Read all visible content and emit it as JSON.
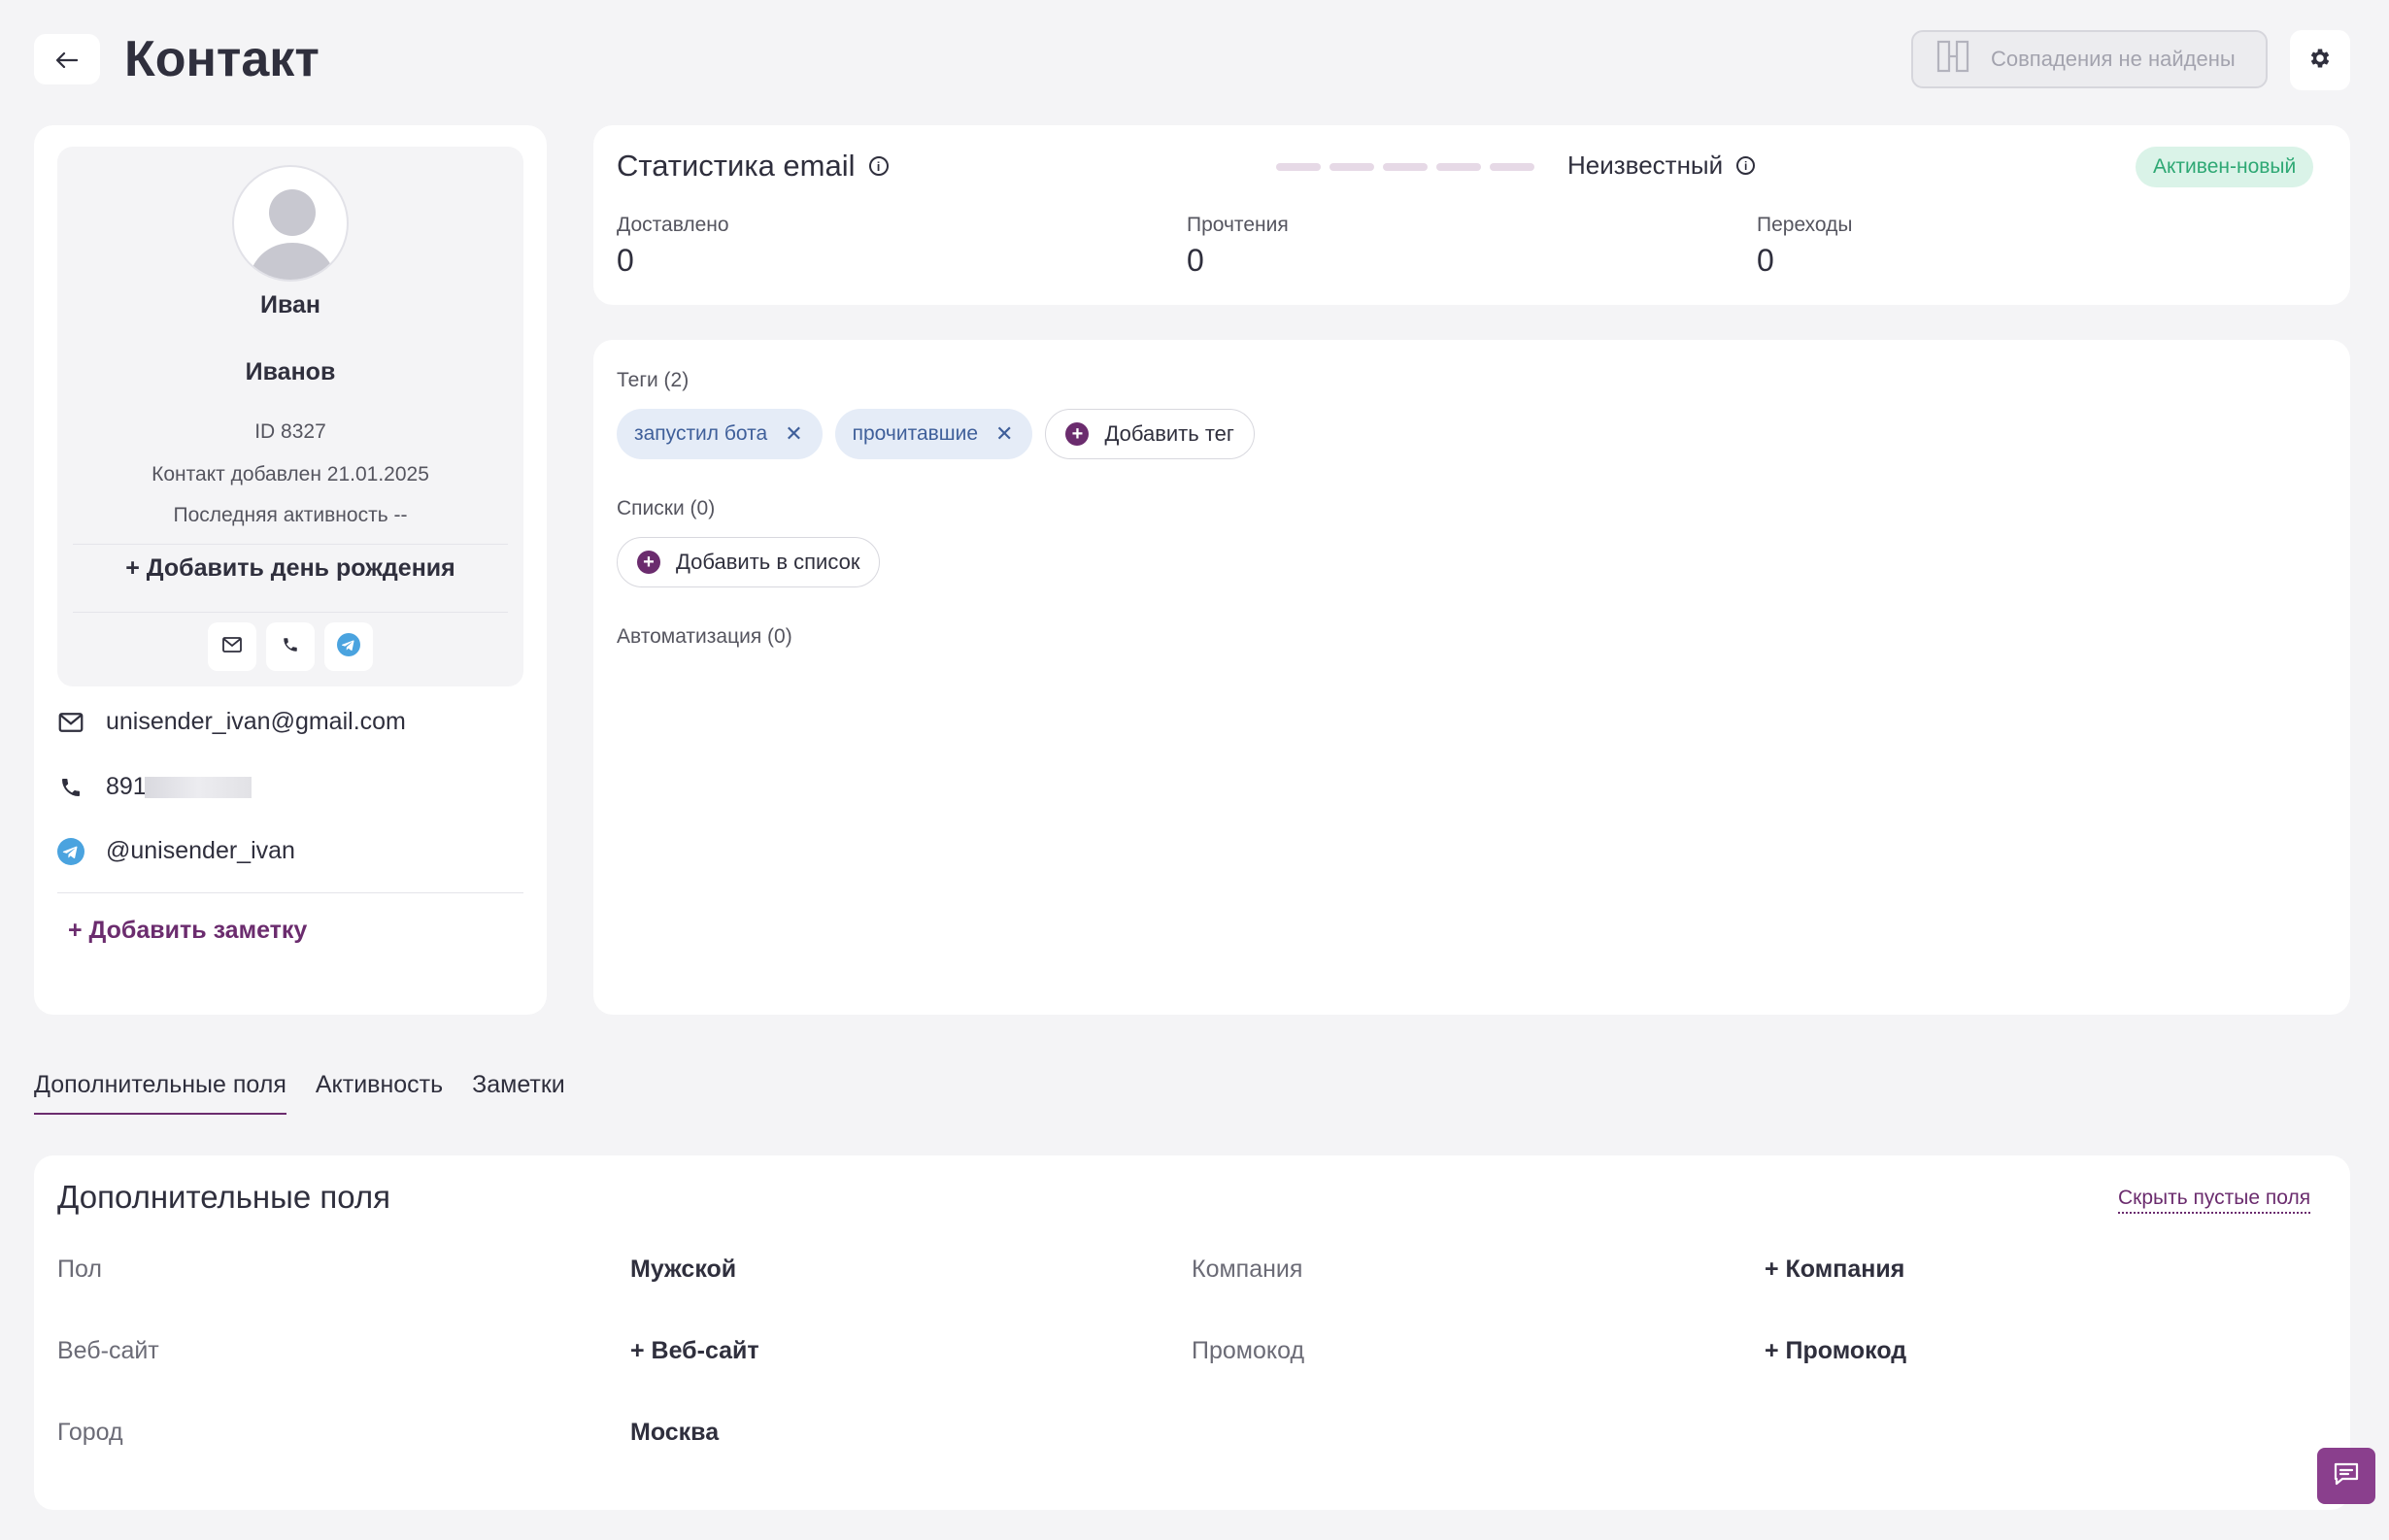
{
  "header": {
    "back_icon": "arrow-left-icon",
    "title": "Контакт",
    "matches_label": "Совпадения не найдены",
    "settings_icon": "gear-icon"
  },
  "profile": {
    "first_name": "Иван",
    "last_name": "Иванов",
    "id_label": "ID 8327",
    "added_label": "Контакт добавлен 21.01.2025",
    "last_activity_label": "Последняя активность --",
    "add_birthday": "+ Добавить день рождения",
    "email": "unisender_ivan@gmail.com",
    "phone_visible": "891",
    "telegram": "@unisender_ivan",
    "add_note": "+ Добавить заметку"
  },
  "email_stats": {
    "title": "Статистика email",
    "rating_label": "Неизвестный",
    "status": "Активен-новый",
    "metrics": [
      {
        "label": "Доставлено",
        "value": "0"
      },
      {
        "label": "Прочтения",
        "value": "0"
      },
      {
        "label": "Переходы",
        "value": "0"
      }
    ]
  },
  "tags": {
    "label": "Теги (2)",
    "items": [
      "запустил бота",
      "прочитавшие"
    ],
    "add_label": "Добавить тег"
  },
  "lists": {
    "label": "Списки (0)",
    "add_label": "Добавить в список"
  },
  "automation": {
    "label": "Автоматизация (0)"
  },
  "tabs": [
    "Дополнительные поля",
    "Активность",
    "Заметки"
  ],
  "extra_fields": {
    "title": "Дополнительные поля",
    "hide_empty": "Скрыть пустые поля",
    "rows": [
      {
        "label": "Пол",
        "value": "Мужской"
      },
      {
        "label": "Компания",
        "value": "+ Компания"
      },
      {
        "label": "Веб-сайт",
        "value": "+ Веб-сайт"
      },
      {
        "label": "Промокод",
        "value": "+ Промокод"
      },
      {
        "label": "Город",
        "value": "Москва"
      }
    ]
  },
  "colors": {
    "accent": "#6b2c6e",
    "status_bg": "#daf3e8",
    "status_text": "#2ea874",
    "tag_bg": "#e5ecf7",
    "telegram": "#4aa3df"
  }
}
